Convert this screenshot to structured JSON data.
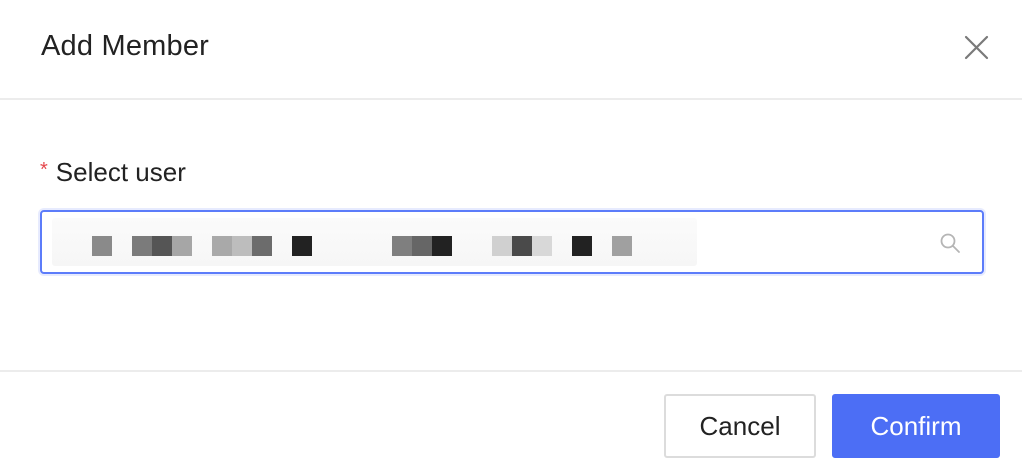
{
  "dialog": {
    "title": "Add Member",
    "close_icon": "close-icon"
  },
  "form": {
    "field_label": "Select user",
    "required_mark": "*",
    "selected_value": "",
    "search_icon": "search-icon"
  },
  "footer": {
    "cancel_label": "Cancel",
    "confirm_label": "Confirm"
  },
  "colors": {
    "accent": "#4c6ef5",
    "input_focus_border": "#5c7cfa",
    "required": "#e5484d",
    "divider": "#ececec"
  }
}
